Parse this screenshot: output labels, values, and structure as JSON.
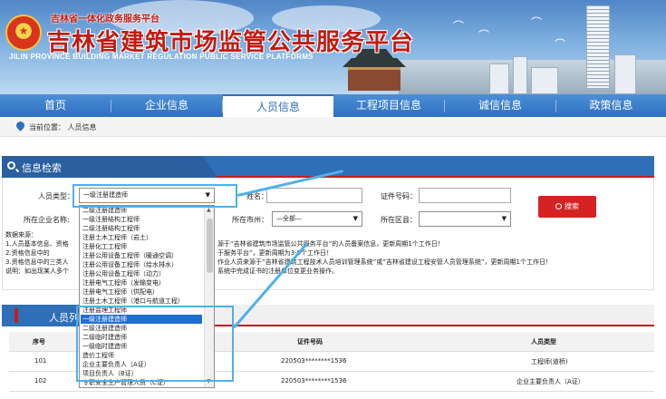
{
  "header": {
    "sub_title": "吉林省一体化政务服务平台",
    "title": "吉林省建筑市场监管公共服务平台",
    "en_title": "JILIN PROVINCE BUILDING MARKET REGULATION PUBLIC SERVICE PLATFORMS"
  },
  "nav": {
    "items": [
      {
        "label": "首页"
      },
      {
        "label": "企业信息"
      },
      {
        "label": "人员信息"
      },
      {
        "label": "工程项目信息"
      },
      {
        "label": "诚信信息"
      },
      {
        "label": "政策信息"
      }
    ],
    "active_index": 2
  },
  "breadcrumb": {
    "prefix": "当前位置：",
    "current": "人员信息"
  },
  "search": {
    "title": "信息检索",
    "person_type_label": "人员类型：",
    "person_type_value": "一级注册建造师",
    "name_label": "姓名：",
    "cert_label": "证件号码：",
    "company_label": "所在企业名称:",
    "city_label": "所在市州：",
    "city_value": "—全部—",
    "district_label": "所在区县：",
    "button_label": "搜索"
  },
  "notes": [
    "数据来源：",
    "1.人员基本信息、资格",
    "2.资格信息中的",
    "3.资格信息中的三类人",
    "说明：如出现某人多个"
  ],
  "notes_right": [
    "源于“吉林省建筑市场监管公共服务平台”的人员备案信息，更新周期1个工作日！",
    "于服务平台”，更新周期为3-5个工作日！",
    "作业人员来源于“吉林省建筑工程技术人员培训管理系统”或“吉林省建设工程安管人员管理系统”，更新周期1个工作日！",
    "系统中完成证书的注册单位变更业务操作。"
  ],
  "results": {
    "title": "人员列表",
    "columns": [
      "序号",
      "证件号码",
      "人员类型"
    ],
    "rows": [
      {
        "no": "101",
        "cert": "220503********1536",
        "type": "工程师(道桥)"
      },
      {
        "no": "102",
        "cert": "220503********1536",
        "type": "企业主要负责人（A证）"
      }
    ]
  },
  "dropdown": {
    "options": [
      "二级注册建造师",
      "一级注册结构工程师",
      "二级注册结构工程师",
      "注册土木工程师（岩土）",
      "注册化工工程师",
      "注册公用设备工程师（暖通空调）",
      "注册公用设备工程师（给水排水）",
      "注册公用设备工程师（动力）",
      "注册电气工程师（发输变电）",
      "注册电气工程师（供配电）",
      "注册土木工程师（港口与航道工程）",
      "注册监理工程师",
      "一级注册建造师",
      "二级注册建造师",
      "二级临时建造师",
      "一级临时建造师",
      "造价工程师",
      "企业主要负责人（A证）",
      "项目负责人（B证）",
      "专职安全生产管理人员（C证）"
    ],
    "selected_index": 12
  },
  "colors": {
    "nav_blue": "#2d6fbf",
    "accent_red": "#c31d20",
    "highlight": "#4fb0ec",
    "selected": "#1f6fd3"
  }
}
